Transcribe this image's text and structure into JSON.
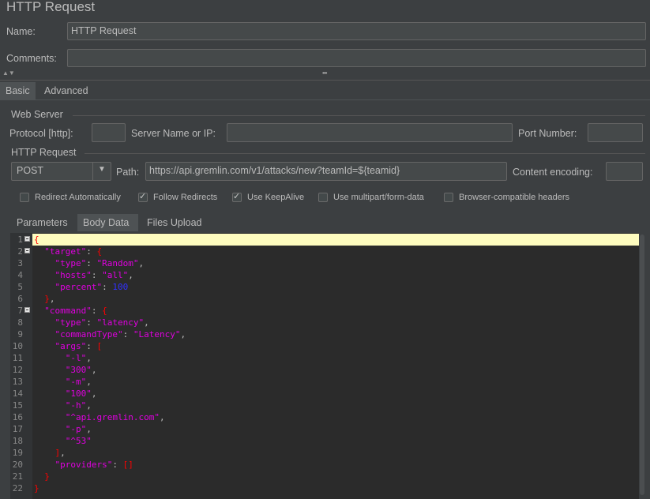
{
  "title": "HTTP Request",
  "name_label": "Name:",
  "name_value": "HTTP Request",
  "comments_label": "Comments:",
  "comments_value": "",
  "splitter_dots": "•••",
  "tabs": [
    "Basic",
    "Advanced"
  ],
  "web_server": {
    "section": "Web Server",
    "protocol_label": "Protocol [http]:",
    "protocol_value": "",
    "server_label": "Server Name or IP:",
    "server_value": "",
    "port_label": "Port Number:",
    "port_value": ""
  },
  "http_request": {
    "section": "HTTP Request",
    "method": "POST",
    "path_label": "Path:",
    "path_value": "https://api.gremlin.com/v1/attacks/new?teamId=${teamid}",
    "encoding_label": "Content encoding:",
    "encoding_value": ""
  },
  "checkboxes": [
    {
      "label": "Redirect Automatically",
      "checked": false
    },
    {
      "label": "Follow Redirects",
      "checked": true
    },
    {
      "label": "Use KeepAlive",
      "checked": true
    },
    {
      "label": "Use multipart/form-data",
      "checked": false
    },
    {
      "label": "Browser-compatible headers",
      "checked": false
    }
  ],
  "sub_tabs": [
    "Parameters",
    "Body Data",
    "Files Upload"
  ],
  "body_lines": [
    [
      [
        "{",
        "#ff0000"
      ]
    ],
    [
      [
        "  ",
        "#bbbbbb"
      ],
      [
        "\"target\"",
        "#e000e0"
      ],
      [
        ": ",
        "#bbbbbb"
      ],
      [
        "{",
        "#ff0000"
      ]
    ],
    [
      [
        "    ",
        "#bbbbbb"
      ],
      [
        "\"type\"",
        "#e000e0"
      ],
      [
        ": ",
        "#bbbbbb"
      ],
      [
        "\"Random\"",
        "#e000e0"
      ],
      [
        ",",
        "#bbbbbb"
      ]
    ],
    [
      [
        "    ",
        "#bbbbbb"
      ],
      [
        "\"hosts\"",
        "#e000e0"
      ],
      [
        ": ",
        "#bbbbbb"
      ],
      [
        "\"all\"",
        "#e000e0"
      ],
      [
        ",",
        "#bbbbbb"
      ]
    ],
    [
      [
        "    ",
        "#bbbbbb"
      ],
      [
        "\"percent\"",
        "#e000e0"
      ],
      [
        ": ",
        "#bbbbbb"
      ],
      [
        "100",
        "#3030ff"
      ]
    ],
    [
      [
        "  ",
        "#bbbbbb"
      ],
      [
        "}",
        "#ff0000"
      ],
      [
        ",",
        "#bbbbbb"
      ]
    ],
    [
      [
        "  ",
        "#bbbbbb"
      ],
      [
        "\"command\"",
        "#e000e0"
      ],
      [
        ": ",
        "#bbbbbb"
      ],
      [
        "{",
        "#ff0000"
      ]
    ],
    [
      [
        "    ",
        "#bbbbbb"
      ],
      [
        "\"type\"",
        "#e000e0"
      ],
      [
        ": ",
        "#bbbbbb"
      ],
      [
        "\"latency\"",
        "#e000e0"
      ],
      [
        ",",
        "#bbbbbb"
      ]
    ],
    [
      [
        "    ",
        "#bbbbbb"
      ],
      [
        "\"commandType\"",
        "#e000e0"
      ],
      [
        ": ",
        "#bbbbbb"
      ],
      [
        "\"Latency\"",
        "#e000e0"
      ],
      [
        ",",
        "#bbbbbb"
      ]
    ],
    [
      [
        "    ",
        "#bbbbbb"
      ],
      [
        "\"args\"",
        "#e000e0"
      ],
      [
        ": ",
        "#bbbbbb"
      ],
      [
        "[",
        "#ff0000"
      ]
    ],
    [
      [
        "      ",
        "#bbbbbb"
      ],
      [
        "\"-l\"",
        "#e000e0"
      ],
      [
        ",",
        "#bbbbbb"
      ]
    ],
    [
      [
        "      ",
        "#bbbbbb"
      ],
      [
        "\"300\"",
        "#e000e0"
      ],
      [
        ",",
        "#bbbbbb"
      ]
    ],
    [
      [
        "      ",
        "#bbbbbb"
      ],
      [
        "\"-m\"",
        "#e000e0"
      ],
      [
        ",",
        "#bbbbbb"
      ]
    ],
    [
      [
        "      ",
        "#bbbbbb"
      ],
      [
        "\"100\"",
        "#e000e0"
      ],
      [
        ",",
        "#bbbbbb"
      ]
    ],
    [
      [
        "      ",
        "#bbbbbb"
      ],
      [
        "\"-h\"",
        "#e000e0"
      ],
      [
        ",",
        "#bbbbbb"
      ]
    ],
    [
      [
        "      ",
        "#bbbbbb"
      ],
      [
        "\"^api.gremlin.com\"",
        "#e000e0"
      ],
      [
        ",",
        "#bbbbbb"
      ]
    ],
    [
      [
        "      ",
        "#bbbbbb"
      ],
      [
        "\"-p\"",
        "#e000e0"
      ],
      [
        ",",
        "#bbbbbb"
      ]
    ],
    [
      [
        "      ",
        "#bbbbbb"
      ],
      [
        "\"^53\"",
        "#e000e0"
      ]
    ],
    [
      [
        "    ",
        "#bbbbbb"
      ],
      [
        "]",
        "#ff0000"
      ],
      [
        ",",
        "#bbbbbb"
      ]
    ],
    [
      [
        "    ",
        "#bbbbbb"
      ],
      [
        "\"providers\"",
        "#e000e0"
      ],
      [
        ": ",
        "#bbbbbb"
      ],
      [
        "[]",
        "#ff0000"
      ]
    ],
    [
      [
        "  ",
        "#bbbbbb"
      ],
      [
        "}",
        "#ff0000"
      ]
    ],
    [
      [
        "}",
        "#ff0000"
      ]
    ]
  ],
  "fold_lines": [
    1,
    2,
    7
  ],
  "highlighted_line": 1
}
